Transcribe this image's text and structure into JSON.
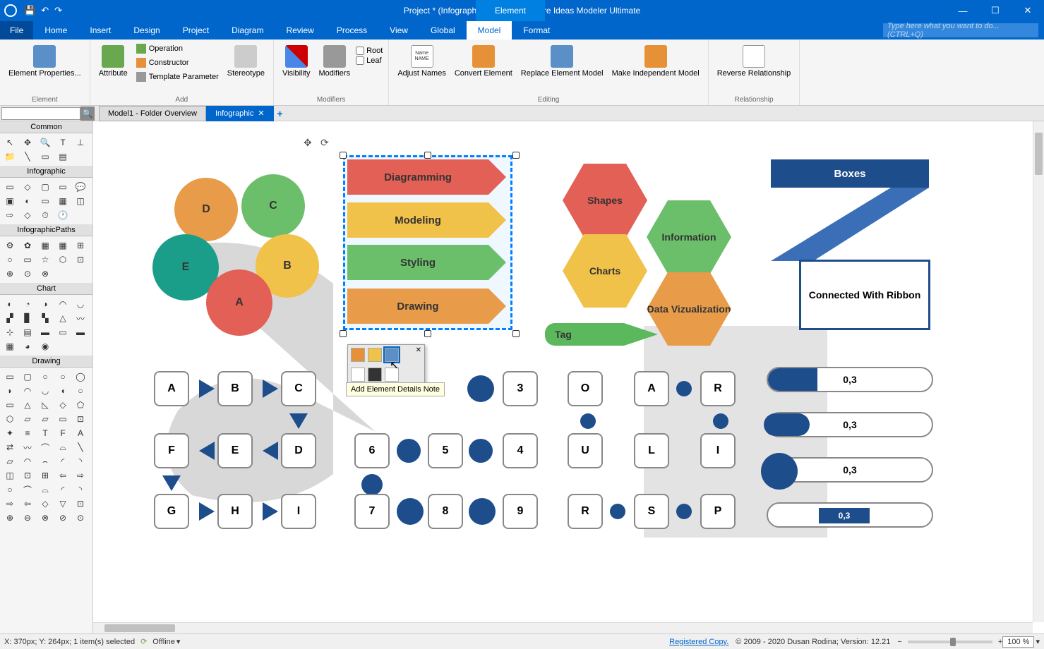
{
  "title": "Project * (Infographics.simp) - Software Ideas Modeler Ultimate",
  "context_tab": "Element",
  "menu": {
    "file": "File",
    "tabs": [
      "Home",
      "Insert",
      "Design",
      "Project",
      "Diagram",
      "Review",
      "Process",
      "View",
      "Global",
      "Model",
      "Format"
    ],
    "active": "Model",
    "search_placeholder": "Type here what you want to do... (CTRL+Q)"
  },
  "ribbon": {
    "element": {
      "label": "Element",
      "item": "Element Properties..."
    },
    "add": {
      "label": "Add",
      "attribute": "Attribute",
      "operation": "Operation",
      "constructor": "Constructor",
      "template": "Template Parameter",
      "stereotype": "Stereotype"
    },
    "modifiers": {
      "label": "Modifiers",
      "visibility": "Visibility",
      "modifiers": "Modifiers",
      "root": "Root",
      "leaf": "Leaf"
    },
    "editing": {
      "label": "Editing",
      "adjust": "Adjust Names",
      "convert": "Convert Element",
      "replace": "Replace Element Model",
      "independent": "Make Independent Model"
    },
    "relationship": {
      "label": "Relationship",
      "reverse": "Reverse Relationship"
    }
  },
  "doc_tabs": {
    "tab1": "Model1 - Folder Overview",
    "tab2": "Infographic"
  },
  "sidebar": {
    "common": "Common",
    "infographic": "Infographic",
    "infpaths": "InfographicPaths",
    "chart": "Chart",
    "drawing": "Drawing"
  },
  "canvas": {
    "circles": {
      "a": "A",
      "b": "B",
      "c": "C",
      "d": "D",
      "e": "E"
    },
    "bands": {
      "b1": "Diagramming",
      "b2": "Modeling",
      "b3": "Styling",
      "b4": "Drawing"
    },
    "hex": {
      "shapes": "Shapes",
      "charts": "Charts",
      "info": "Information",
      "dataviz": "Data Vizualization"
    },
    "boxes_title": "Boxes",
    "connected": "Connected With Ribbon",
    "tag": "Tag",
    "grid1": [
      "A",
      "B",
      "C",
      "F",
      "E",
      "D",
      "G",
      "H",
      "I"
    ],
    "grid2": [
      "3",
      "6",
      "5",
      "4",
      "7",
      "8",
      "9"
    ],
    "grid3": [
      "O",
      "A",
      "R",
      "U",
      "L",
      "I",
      "R",
      "S",
      "P"
    ],
    "bars": [
      "0,3",
      "0,3",
      "0,3",
      "0,3"
    ],
    "popup_tip": "Add Element Details Note"
  },
  "status": {
    "coords": "X: 370px; Y: 264px; 1 item(s) selected",
    "offline": "Offline",
    "registered": "Registered Copy.",
    "copyright": "© 2009 - 2020 Dusan Rodina; Version: 12.21",
    "zoom": "100 %"
  }
}
